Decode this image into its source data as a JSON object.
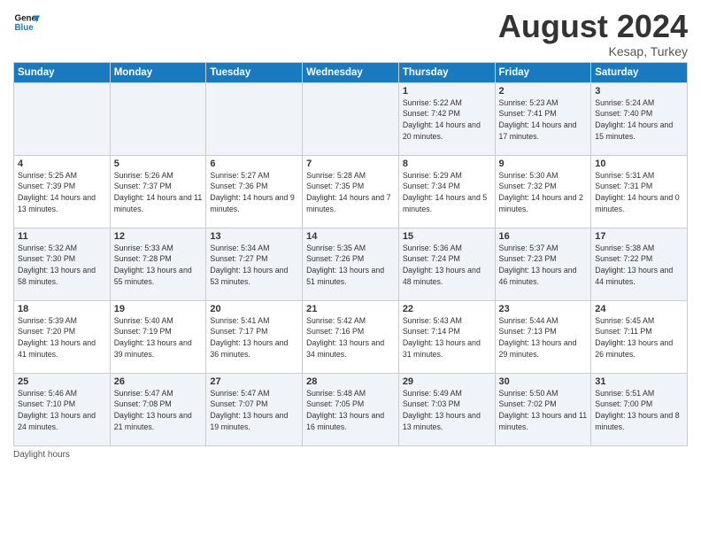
{
  "header": {
    "logo_line1": "General",
    "logo_line2": "Blue",
    "month_title": "August 2024",
    "location": "Kesap, Turkey"
  },
  "days_of_week": [
    "Sunday",
    "Monday",
    "Tuesday",
    "Wednesday",
    "Thursday",
    "Friday",
    "Saturday"
  ],
  "weeks": [
    [
      {
        "day": "",
        "info": ""
      },
      {
        "day": "",
        "info": ""
      },
      {
        "day": "",
        "info": ""
      },
      {
        "day": "",
        "info": ""
      },
      {
        "day": "1",
        "info": "Sunrise: 5:22 AM\nSunset: 7:42 PM\nDaylight: 14 hours and 20 minutes."
      },
      {
        "day": "2",
        "info": "Sunrise: 5:23 AM\nSunset: 7:41 PM\nDaylight: 14 hours and 17 minutes."
      },
      {
        "day": "3",
        "info": "Sunrise: 5:24 AM\nSunset: 7:40 PM\nDaylight: 14 hours and 15 minutes."
      }
    ],
    [
      {
        "day": "4",
        "info": "Sunrise: 5:25 AM\nSunset: 7:39 PM\nDaylight: 14 hours and 13 minutes."
      },
      {
        "day": "5",
        "info": "Sunrise: 5:26 AM\nSunset: 7:37 PM\nDaylight: 14 hours and 11 minutes."
      },
      {
        "day": "6",
        "info": "Sunrise: 5:27 AM\nSunset: 7:36 PM\nDaylight: 14 hours and 9 minutes."
      },
      {
        "day": "7",
        "info": "Sunrise: 5:28 AM\nSunset: 7:35 PM\nDaylight: 14 hours and 7 minutes."
      },
      {
        "day": "8",
        "info": "Sunrise: 5:29 AM\nSunset: 7:34 PM\nDaylight: 14 hours and 5 minutes."
      },
      {
        "day": "9",
        "info": "Sunrise: 5:30 AM\nSunset: 7:32 PM\nDaylight: 14 hours and 2 minutes."
      },
      {
        "day": "10",
        "info": "Sunrise: 5:31 AM\nSunset: 7:31 PM\nDaylight: 14 hours and 0 minutes."
      }
    ],
    [
      {
        "day": "11",
        "info": "Sunrise: 5:32 AM\nSunset: 7:30 PM\nDaylight: 13 hours and 58 minutes."
      },
      {
        "day": "12",
        "info": "Sunrise: 5:33 AM\nSunset: 7:28 PM\nDaylight: 13 hours and 55 minutes."
      },
      {
        "day": "13",
        "info": "Sunrise: 5:34 AM\nSunset: 7:27 PM\nDaylight: 13 hours and 53 minutes."
      },
      {
        "day": "14",
        "info": "Sunrise: 5:35 AM\nSunset: 7:26 PM\nDaylight: 13 hours and 51 minutes."
      },
      {
        "day": "15",
        "info": "Sunrise: 5:36 AM\nSunset: 7:24 PM\nDaylight: 13 hours and 48 minutes."
      },
      {
        "day": "16",
        "info": "Sunrise: 5:37 AM\nSunset: 7:23 PM\nDaylight: 13 hours and 46 minutes."
      },
      {
        "day": "17",
        "info": "Sunrise: 5:38 AM\nSunset: 7:22 PM\nDaylight: 13 hours and 44 minutes."
      }
    ],
    [
      {
        "day": "18",
        "info": "Sunrise: 5:39 AM\nSunset: 7:20 PM\nDaylight: 13 hours and 41 minutes."
      },
      {
        "day": "19",
        "info": "Sunrise: 5:40 AM\nSunset: 7:19 PM\nDaylight: 13 hours and 39 minutes."
      },
      {
        "day": "20",
        "info": "Sunrise: 5:41 AM\nSunset: 7:17 PM\nDaylight: 13 hours and 36 minutes."
      },
      {
        "day": "21",
        "info": "Sunrise: 5:42 AM\nSunset: 7:16 PM\nDaylight: 13 hours and 34 minutes."
      },
      {
        "day": "22",
        "info": "Sunrise: 5:43 AM\nSunset: 7:14 PM\nDaylight: 13 hours and 31 minutes."
      },
      {
        "day": "23",
        "info": "Sunrise: 5:44 AM\nSunset: 7:13 PM\nDaylight: 13 hours and 29 minutes."
      },
      {
        "day": "24",
        "info": "Sunrise: 5:45 AM\nSunset: 7:11 PM\nDaylight: 13 hours and 26 minutes."
      }
    ],
    [
      {
        "day": "25",
        "info": "Sunrise: 5:46 AM\nSunset: 7:10 PM\nDaylight: 13 hours and 24 minutes."
      },
      {
        "day": "26",
        "info": "Sunrise: 5:47 AM\nSunset: 7:08 PM\nDaylight: 13 hours and 21 minutes."
      },
      {
        "day": "27",
        "info": "Sunrise: 5:47 AM\nSunset: 7:07 PM\nDaylight: 13 hours and 19 minutes."
      },
      {
        "day": "28",
        "info": "Sunrise: 5:48 AM\nSunset: 7:05 PM\nDaylight: 13 hours and 16 minutes."
      },
      {
        "day": "29",
        "info": "Sunrise: 5:49 AM\nSunset: 7:03 PM\nDaylight: 13 hours and 13 minutes."
      },
      {
        "day": "30",
        "info": "Sunrise: 5:50 AM\nSunset: 7:02 PM\nDaylight: 13 hours and 11 minutes."
      },
      {
        "day": "31",
        "info": "Sunrise: 5:51 AM\nSunset: 7:00 PM\nDaylight: 13 hours and 8 minutes."
      }
    ]
  ],
  "footer": {
    "daylight_label": "Daylight hours"
  }
}
